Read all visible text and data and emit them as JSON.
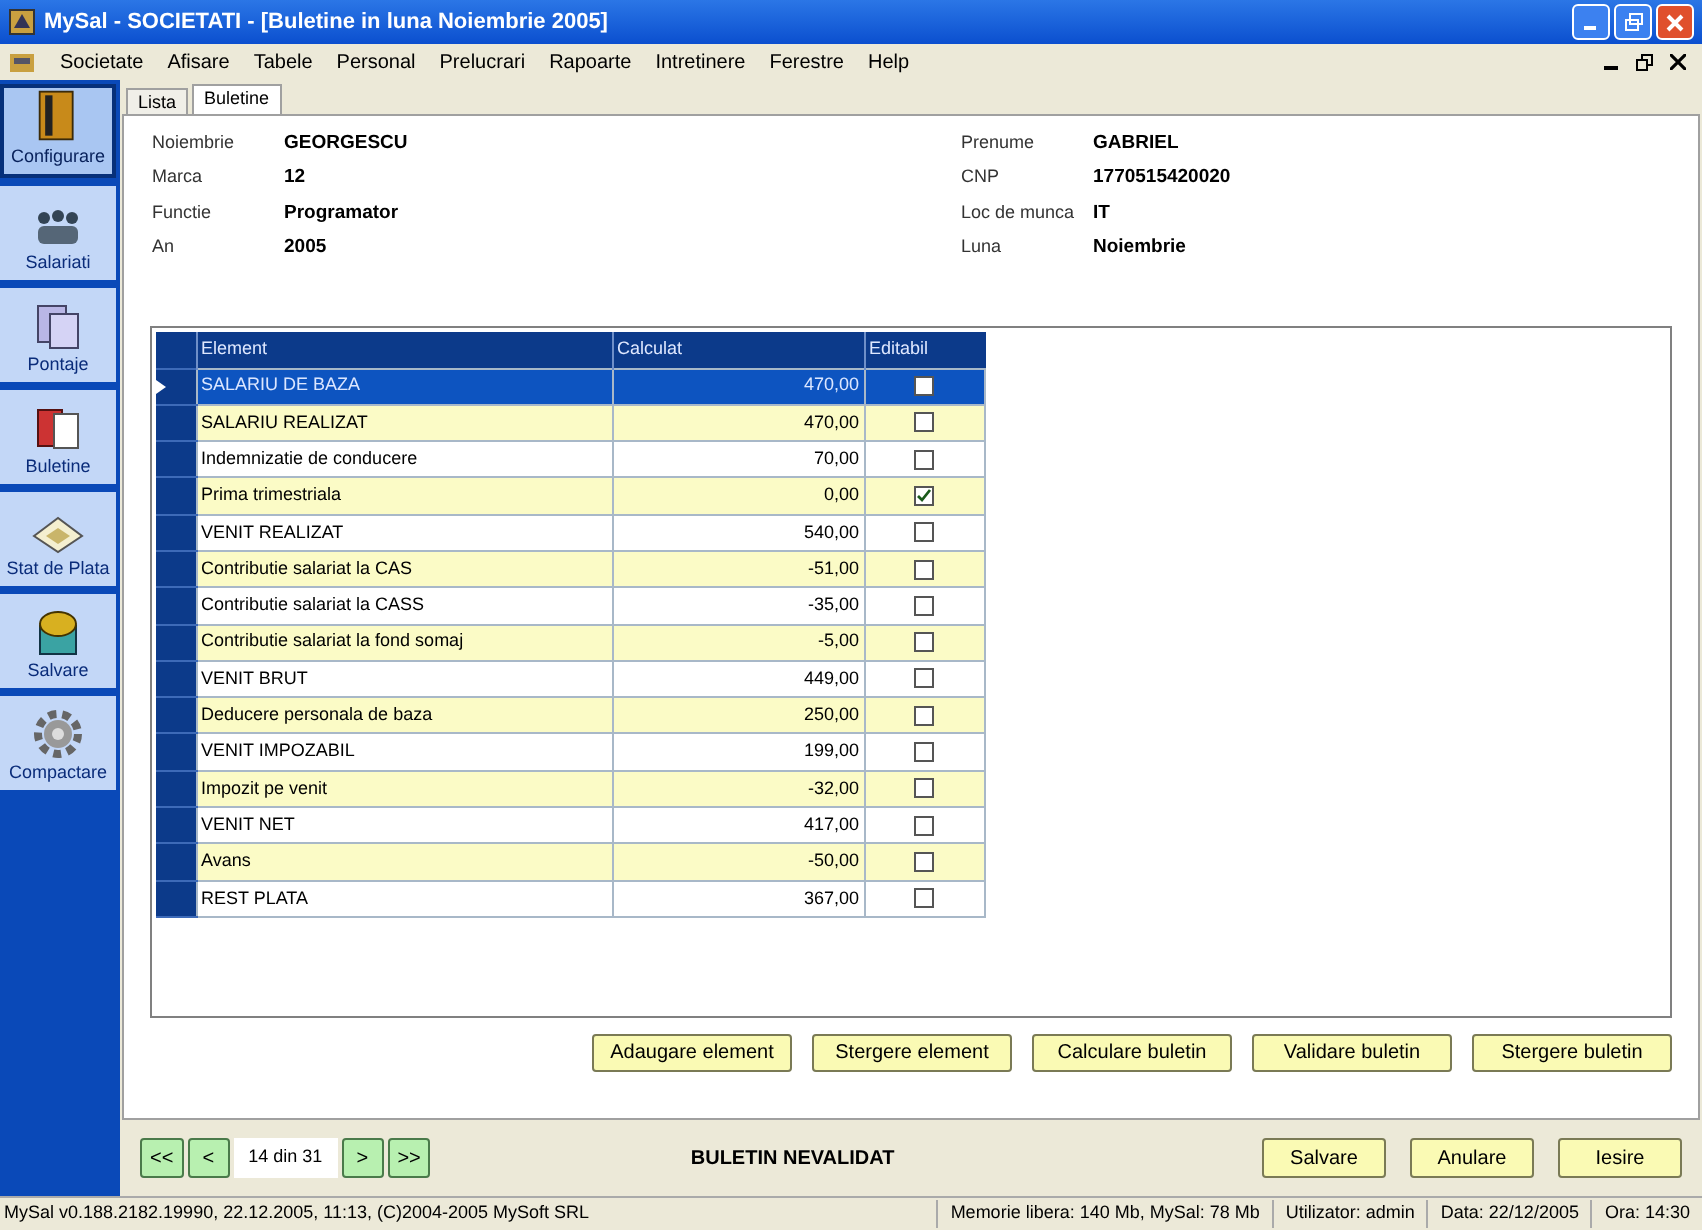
{
  "window": {
    "title": "MySal - SOCIETATI - [Buletine in luna Noiembrie 2005]"
  },
  "menu": [
    "Societate",
    "Afisare",
    "Tabele",
    "Personal",
    "Prelucrari",
    "Rapoarte",
    "Intretinere",
    "Ferestre",
    "Help"
  ],
  "sidebar": {
    "items": [
      {
        "label": "Configurare",
        "selected": true
      },
      {
        "label": "Salariati",
        "selected": false
      },
      {
        "label": "Pontaje",
        "selected": false
      },
      {
        "label": "Buletine",
        "selected": false
      },
      {
        "label": "Stat de Plata",
        "selected": false
      },
      {
        "label": "Salvare",
        "selected": false
      },
      {
        "label": "Compactare",
        "selected": false
      }
    ]
  },
  "tabs": [
    {
      "label": "Lista",
      "selected": false
    },
    {
      "label": "Buletine",
      "selected": true
    }
  ],
  "employee": {
    "left": [
      {
        "label": "Noiembrie",
        "value": "GEORGESCU"
      },
      {
        "label": "Marca",
        "value": "12"
      },
      {
        "label": "Functie",
        "value": "Programator"
      },
      {
        "label": "An",
        "value": "2005"
      }
    ],
    "right": [
      {
        "label": "Prenume",
        "value": "GABRIEL"
      },
      {
        "label": "CNP",
        "value": "1770515420020"
      },
      {
        "label": "Loc de munca",
        "value": "IT"
      },
      {
        "label": "Luna",
        "value": "Noiembrie"
      }
    ]
  },
  "table": {
    "columns": [
      "Element",
      "Calculat",
      "Editabil"
    ],
    "rows": [
      {
        "element": "SALARIU DE BAZA",
        "calculat": "470,00",
        "editabil": false,
        "selected": true
      },
      {
        "element": "SALARIU REALIZAT",
        "calculat": "470,00",
        "editabil": false,
        "selected": false
      },
      {
        "element": "Indemnizatie de conducere",
        "calculat": "70,00",
        "editabil": false,
        "selected": false
      },
      {
        "element": "Prima trimestriala",
        "calculat": "0,00",
        "editabil": true,
        "selected": false
      },
      {
        "element": "VENIT REALIZAT",
        "calculat": "540,00",
        "editabil": false,
        "selected": false
      },
      {
        "element": "Contributie salariat la CAS",
        "calculat": "-51,00",
        "editabil": false,
        "selected": false
      },
      {
        "element": "Contributie salariat la CASS",
        "calculat": "-35,00",
        "editabil": false,
        "selected": false
      },
      {
        "element": "Contributie salariat la fond somaj",
        "calculat": "-5,00",
        "editabil": false,
        "selected": false
      },
      {
        "element": "VENIT BRUT",
        "calculat": "449,00",
        "editabil": false,
        "selected": false
      },
      {
        "element": "Deducere personala de baza",
        "calculat": "250,00",
        "editabil": false,
        "selected": false
      },
      {
        "element": "VENIT IMPOZABIL",
        "calculat": "199,00",
        "editabil": false,
        "selected": false
      },
      {
        "element": "Impozit pe venit",
        "calculat": "-32,00",
        "editabil": false,
        "selected": false
      },
      {
        "element": "VENIT NET",
        "calculat": "417,00",
        "editabil": false,
        "selected": false
      },
      {
        "element": "Avans",
        "calculat": "-50,00",
        "editabil": false,
        "selected": false
      },
      {
        "element": "REST PLATA",
        "calculat": "367,00",
        "editabil": false,
        "selected": false
      }
    ]
  },
  "actions": [
    "Adaugare element",
    "Stergere element",
    "Calculare buletin",
    "Validare buletin",
    "Stergere buletin"
  ],
  "navigator": {
    "first": "<<",
    "prev": "<",
    "position": "14 din 31",
    "next": ">",
    "last": ">>"
  },
  "bulletin_status": "BULETIN NEVALIDAT",
  "dialog_buttons": [
    "Salvare",
    "Anulare",
    "Iesire"
  ],
  "status_bar": [
    "MySal v0.188.2182.19990, 22.12.2005, 11:13, (C)2004-2005 MySoft SRL",
    "Memorie libera: 140 Mb, MySal: 78 Mb",
    "Utilizator: admin",
    "Data: 22/12/2005",
    "Ora: 14:30"
  ]
}
